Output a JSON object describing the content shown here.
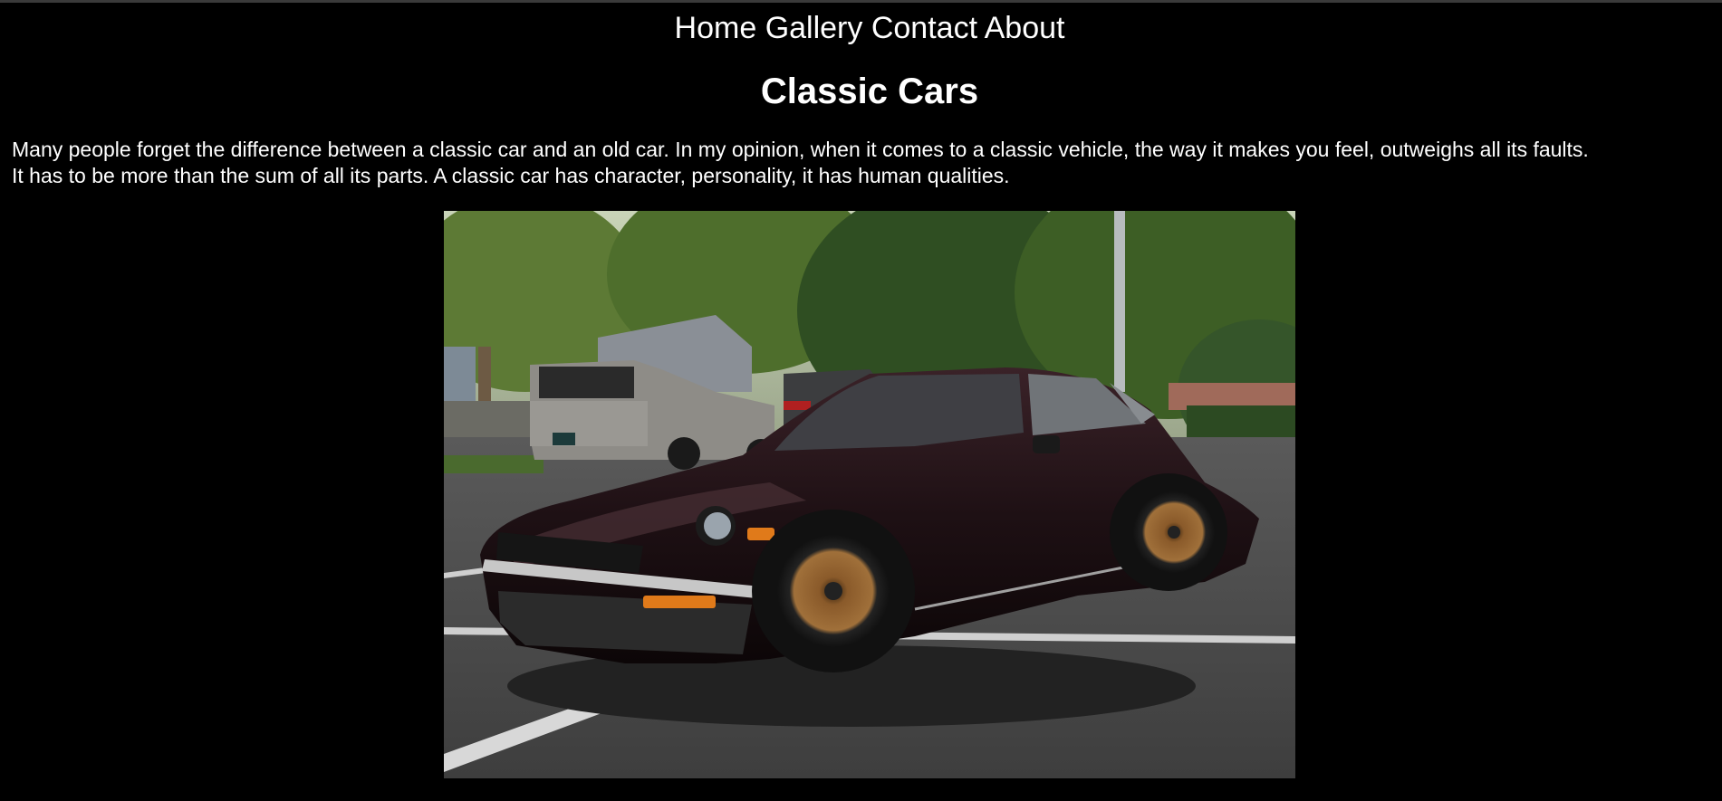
{
  "nav": {
    "items": [
      {
        "label": "Home"
      },
      {
        "label": "Gallery"
      },
      {
        "label": "Contact"
      },
      {
        "label": "About"
      }
    ]
  },
  "page": {
    "title": "Classic Cars",
    "intro_line1": "Many people forget the difference between a classic car and an old car. In my opinion, when it comes to a classic vehicle, the way it makes you feel, outweighs all its faults.",
    "intro_line2": "It has to be more than the sum of all its parts. A classic car has character, personality, it has human qualities."
  },
  "photo": {
    "subject": "Datsun 240Z classic sports car in a parking lot"
  },
  "colors": {
    "background": "#000000",
    "text": "#ffffff"
  }
}
